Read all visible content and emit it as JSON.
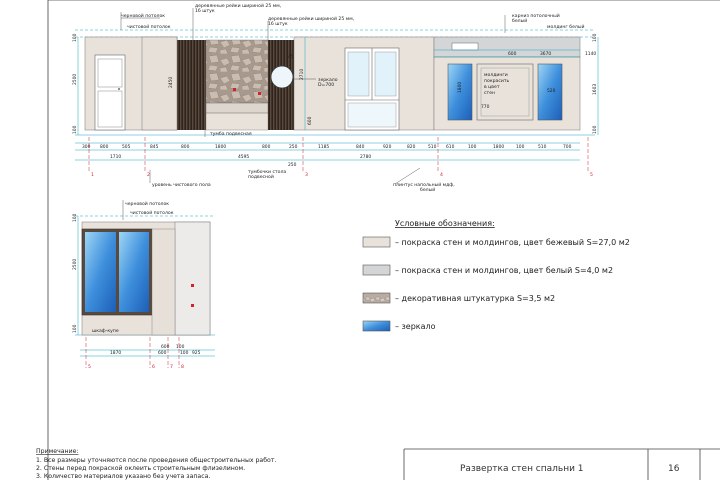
{
  "elevation_a": {
    "callouts": {
      "rough_ceiling": "черновой потолок",
      "finish_ceiling": "чистовой потолок",
      "slats_1": "деревянные рейки шириной 25 мм,",
      "slats_1b": "16 штук",
      "slats_2": "деревянные рейки шириной 25 мм,",
      "slats_2b": "16 штук",
      "mirror": "зеркало",
      "mirror_b": "D=700",
      "tv_stand": "тумба подвесная",
      "rough_floor": "уровень чистового пола",
      "tv_stand2": "тумбочки стола",
      "tv_stand2b": "подвесной",
      "plinth": "плинтус напольный мдф,",
      "plinth_b": "белый",
      "cornice": "карниз потолочный",
      "cornice_b": "белый",
      "wall_colour": "молдинги",
      "wall_colour_b": "покрасить",
      "wall_colour_c": "в цвет",
      "wall_colour_d": "стен",
      "moldings_white": "молдинг белый"
    },
    "dims_bottom_row1": [
      "300",
      "800",
      "505",
      "845",
      "800",
      "1800",
      "800",
      "250",
      "1185",
      "840",
      "920",
      "820",
      "510",
      "610",
      "100",
      "1800",
      "100",
      "510",
      "700"
    ],
    "dims_bottom_row2": [
      "1710",
      "4595",
      "2780"
    ],
    "dims_bottom_row3": [
      "250"
    ],
    "dims_left": [
      "100",
      "2500",
      "100"
    ],
    "dims_right": [
      "100",
      "1603",
      "100"
    ],
    "dims_misc": [
      "2450",
      "2710",
      "600",
      "1800",
      "45",
      "770",
      "3670",
      "600",
      "1140",
      "520"
    ],
    "axis_marks": [
      "1",
      "2",
      "3",
      "4",
      "5"
    ]
  },
  "elevation_b": {
    "callouts": {
      "rough_ceiling": "черновой потолок",
      "finish_ceiling": "чистовой потолок",
      "wardrobe": "шкаф-купе"
    },
    "dims_left": [
      "100",
      "2500",
      "100"
    ],
    "dims_bottom_row1": [
      "1870",
      "600",
      "100",
      "925"
    ],
    "dims_bottom_row2": [
      "100",
      "600"
    ],
    "axis_marks": [
      "5",
      "6",
      "7",
      "8"
    ]
  },
  "legend": {
    "title": "Условные обозначения:",
    "items": [
      {
        "text": "– покраска стен и молдингов, цвет бежевый S=27,0 м2",
        "color": "#e8e2db"
      },
      {
        "text": "– покраска стен и молдингов, цвет белый S=4,0 м2",
        "color": "#d4d5d7"
      },
      {
        "text": "– декоративная штукатурка S=3,5 м2",
        "color": "#b9ada3"
      },
      {
        "text": "– зеркало",
        "color": "#3a8ad6"
      }
    ]
  },
  "notes": {
    "heading": "Примечание:",
    "lines": [
      "1. Все размеры уточняются после проведения общестроительных работ.",
      "2. Стены перед покраской оклеить строительным флизелином.",
      "3. Количество материалов указано без учета запаса."
    ]
  },
  "title_block": {
    "sheet_title": "Развертка стен спальни 1",
    "sheet_number": "16"
  },
  "colors": {
    "beige": "#e8e2db",
    "white_paint": "#d4d5d7",
    "plaster": "#b9ada3",
    "mirror": "#3a8ad6",
    "dim_lines": "#1da6c4",
    "axis": "#d2222a",
    "wood": "#3b3028"
  }
}
